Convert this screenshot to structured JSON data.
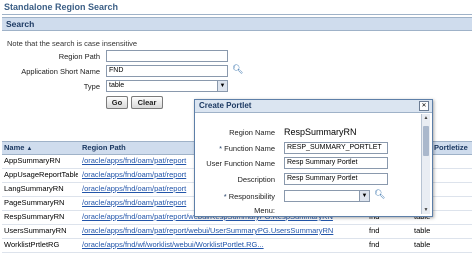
{
  "page": {
    "title": "Standalone Region Search"
  },
  "search": {
    "header": "Search",
    "note": "Note that the search is case insensitive",
    "region_path_label": "Region Path",
    "region_path_value": "",
    "app_short_name_label": "Application Short Name",
    "app_short_name_value": "FND",
    "type_label": "Type",
    "type_value": "table",
    "go_label": "Go",
    "clear_label": "Clear"
  },
  "results": {
    "columns": {
      "name": "Name",
      "region_path": "Region Path",
      "portletize": "Portletize"
    },
    "rows": [
      {
        "name": "AppSummaryRN",
        "path": "/oracle/apps/fnd/oam/pat/report",
        "app": "",
        "type": ""
      },
      {
        "name": "AppUsageReportTable",
        "path": "/oracle/apps/fnd/oam/pat/report",
        "app": "",
        "type": ""
      },
      {
        "name": "LangSummaryRN",
        "path": "/oracle/apps/fnd/oam/pat/report",
        "app": "",
        "type": ""
      },
      {
        "name": "PageSummaryRN",
        "path": "/oracle/apps/fnd/oam/pat/report",
        "app": "",
        "type": ""
      },
      {
        "name": "RespSummaryRN",
        "path": "/oracle/apps/fnd/oam/pat/report/webui/RespSummaryPG.RespSummaryRN",
        "app": "fnd",
        "type": "table"
      },
      {
        "name": "UsersSummaryRN",
        "path": "/oracle/apps/fnd/oam/pat/report/webui/UserSummaryPG.UsersSummaryRN",
        "app": "fnd",
        "type": "table"
      },
      {
        "name": "WorklistPrtletRG",
        "path": "/oracle/apps/fnd/wf/worklist/webui/WorklistPortlet.RG...",
        "app": "fnd",
        "type": "table"
      }
    ]
  },
  "modal": {
    "title": "Create Portlet",
    "close_icon": "close-icon",
    "region_name_label": "Region Name",
    "region_name_value": "RespSummaryRN",
    "function_name_label": "Function Name",
    "function_name_value": "RESP_SUMMARY_PORTLET",
    "user_function_name_label": "User Function Name",
    "user_function_name_value": "Resp Summary Portlet",
    "description_label": "Description",
    "description_value": "Resp Summary Portlet",
    "responsibility_label": "Responsibility",
    "menu_label": "Menu:"
  },
  "colors": {
    "accent": "#3c5f86",
    "header_bg": "#cfdced",
    "link": "#2255aa"
  }
}
